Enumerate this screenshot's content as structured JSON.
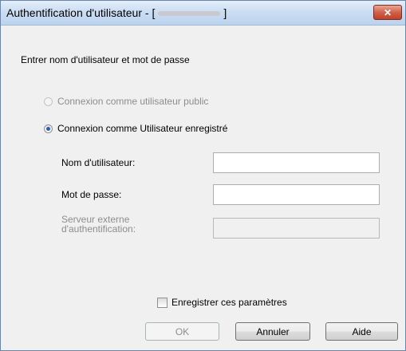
{
  "window": {
    "title_prefix": "Authentification d'utilisateur - [",
    "title_suffix": "]"
  },
  "prompt": "Entrer nom d'utilisateur et mot de passe",
  "options": {
    "public_label": "Connexion comme utilisateur public",
    "registered_label": "Connexion comme Utilisateur enregistré",
    "selected": "registered"
  },
  "fields": {
    "username_label": "Nom d'utilisateur:",
    "username_value": "",
    "password_label": "Mot de passe:",
    "password_value": "",
    "server_label_line1": "Serveur externe",
    "server_label_line2": "d'authentification:",
    "server_value": ""
  },
  "save_settings": {
    "label": "Enregistrer ces paramètres",
    "checked": false
  },
  "buttons": {
    "ok": "OK",
    "cancel": "Annuler",
    "help": "Aide"
  }
}
